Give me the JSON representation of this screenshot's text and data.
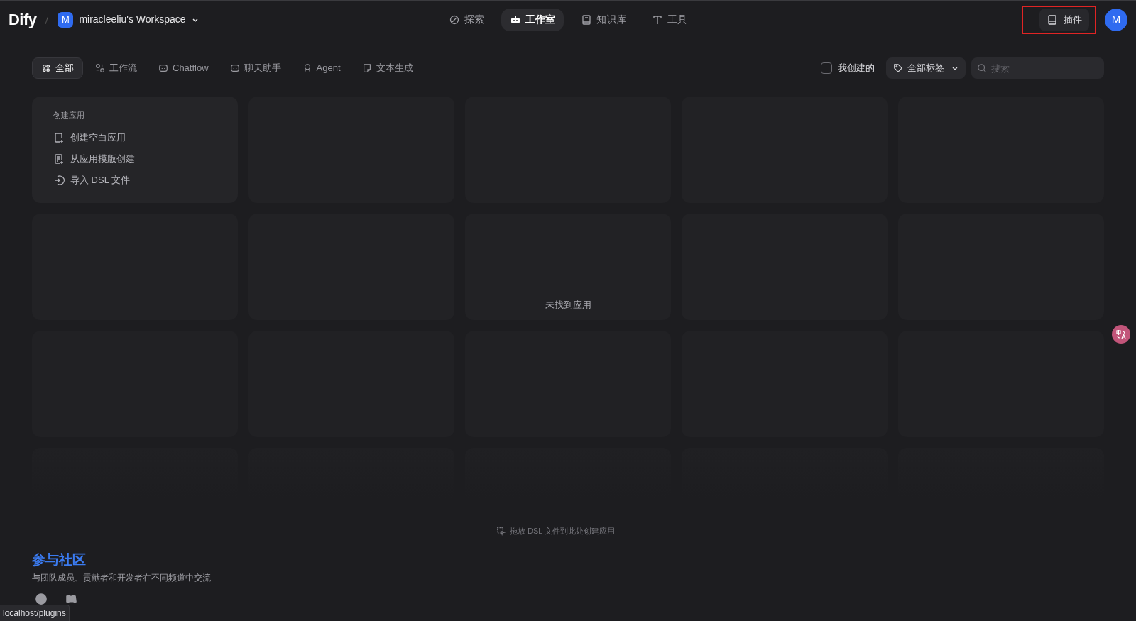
{
  "header": {
    "logo": "Dify",
    "workspace": {
      "avatar": "M",
      "name": "miracleeliu's Workspace"
    },
    "nav": [
      {
        "label": "探索",
        "selected": false
      },
      {
        "label": "工作室",
        "selected": true
      },
      {
        "label": "知识库",
        "selected": false
      },
      {
        "label": "工具",
        "selected": false
      }
    ],
    "plugins": {
      "label": "插件",
      "highlighted": true
    },
    "user_avatar": "M"
  },
  "filters": {
    "tabs": [
      {
        "label": "全部",
        "selected": true
      },
      {
        "label": "工作流",
        "selected": false
      },
      {
        "label": "Chatflow",
        "selected": false
      },
      {
        "label": "聊天助手",
        "selected": false
      },
      {
        "label": "Agent",
        "selected": false
      },
      {
        "label": "文本生成",
        "selected": false
      }
    ],
    "created_by_me": {
      "label": "我创建的",
      "checked": false
    },
    "tags": "全部标签",
    "search": {
      "placeholder": "搜索"
    }
  },
  "create_card": {
    "title": "创建应用",
    "actions": [
      "创建空白应用",
      "从应用模版创建",
      "导入 DSL 文件"
    ]
  },
  "empty_state": "未找到应用",
  "drop_hint": "拖放 DSL 文件到此处创建应用",
  "community": {
    "title": "参与社区",
    "subtitle": "与团队成员、贡献者和开发者在不同频道中交流"
  },
  "status_url": "localhost/plugins"
}
